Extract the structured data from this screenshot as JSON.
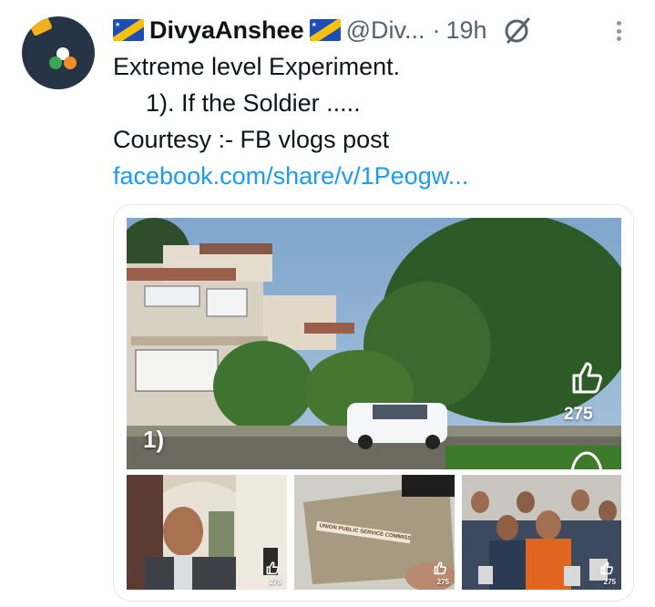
{
  "tweet": {
    "display_name": "DivyaAnshee",
    "handle": "@Div...",
    "separator": "·",
    "time": "19h",
    "lines": [
      "Extreme level Experiment.",
      "1).  If the Soldier .....",
      "Courtesy :- FB vlogs post"
    ],
    "link_text": "facebook.com/share/v/1Peogw..."
  },
  "media": {
    "main_overlay_number": "1)",
    "main_like_count": "275",
    "small_like_counts": [
      "275",
      "275",
      "275"
    ],
    "envelope_text": "UNION PUBLIC SERVICE COMMISSION"
  },
  "icons": {
    "flag": "flag-icon",
    "grok": "grok-icon",
    "more": "more-icon",
    "like": "thumbs-up-icon",
    "comment": "comment-icon"
  },
  "colors": {
    "link": "#1d9bf0",
    "muted": "#536471",
    "text": "#0f1419"
  }
}
